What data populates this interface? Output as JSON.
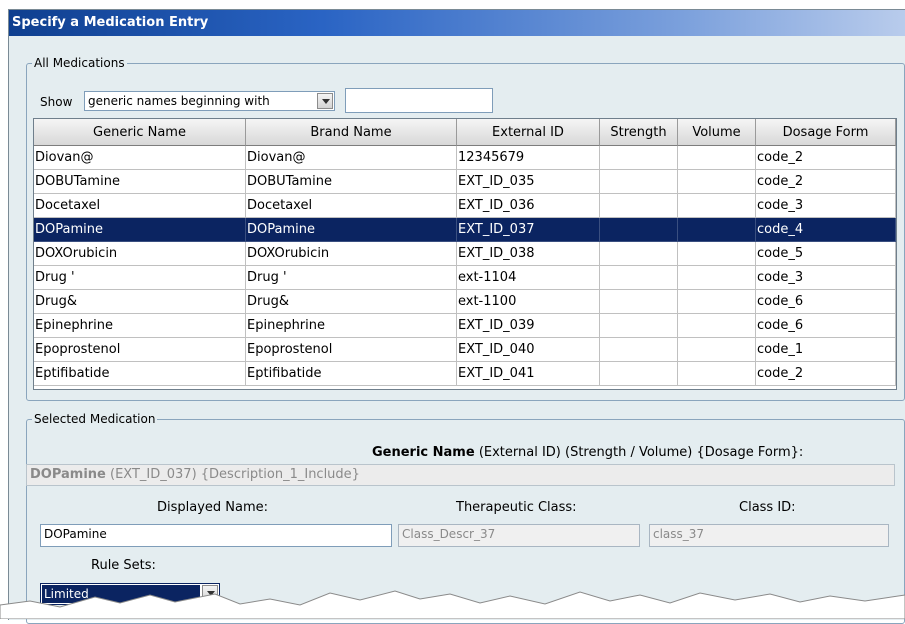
{
  "window": {
    "title": "Specify a Medication Entry"
  },
  "all_medications": {
    "legend": "All Medications",
    "show_label": "Show",
    "filter_option": "generic names beginning with",
    "filter_text": "",
    "columns": [
      "Generic Name",
      "Brand Name",
      "External ID",
      "Strength",
      "Volume",
      "Dosage Form"
    ],
    "rows": [
      [
        "Diovan@",
        "Diovan@",
        "12345679",
        "",
        "",
        "code_2"
      ],
      [
        "DOBUTamine",
        "DOBUTamine",
        "EXT_ID_035",
        "",
        "",
        "code_2"
      ],
      [
        "Docetaxel",
        "Docetaxel",
        "EXT_ID_036",
        "",
        "",
        "code_3"
      ],
      [
        "DOPamine",
        "DOPamine",
        "EXT_ID_037",
        "",
        "",
        "code_4"
      ],
      [
        "DOXOrubicin",
        "DOXOrubicin",
        "EXT_ID_038",
        "",
        "",
        "code_5"
      ],
      [
        "Drug '",
        "Drug '",
        "ext-1104",
        "",
        "",
        "code_3"
      ],
      [
        "Drug&",
        "Drug&",
        "ext-1100",
        "",
        "",
        "code_6"
      ],
      [
        "Epinephrine",
        "Epinephrine",
        "EXT_ID_039",
        "",
        "",
        "code_6"
      ],
      [
        "Epoprostenol",
        "Epoprostenol",
        "EXT_ID_040",
        "",
        "",
        "code_1"
      ],
      [
        "Eptifibatide",
        "Eptifibatide",
        "EXT_ID_041",
        "",
        "",
        "code_2"
      ]
    ],
    "selected_row": 3
  },
  "selected_medication": {
    "legend": "Selected Medication",
    "format_bold": "Generic Name",
    "format_rest": " (External ID)  (Strength / Volume)  {Dosage Form}:",
    "name_bold": "DOPamine",
    "name_rest": " (EXT_ID_037) {Description_1_Include}",
    "displayed_name_label": "Displayed Name:",
    "displayed_name_value": "DOPamine",
    "therapeutic_class_label": "Therapeutic Class:",
    "therapeutic_class_value": "Class_Descr_37",
    "class_id_label": "Class ID:",
    "class_id_value": "class_37",
    "rule_sets_label": "Rule Sets:",
    "rule_sets_value": "Limited"
  },
  "colors": {
    "selection": "#0b2461",
    "title_bar": "#1a4fa8",
    "panel_bg": "#e4edf0"
  }
}
